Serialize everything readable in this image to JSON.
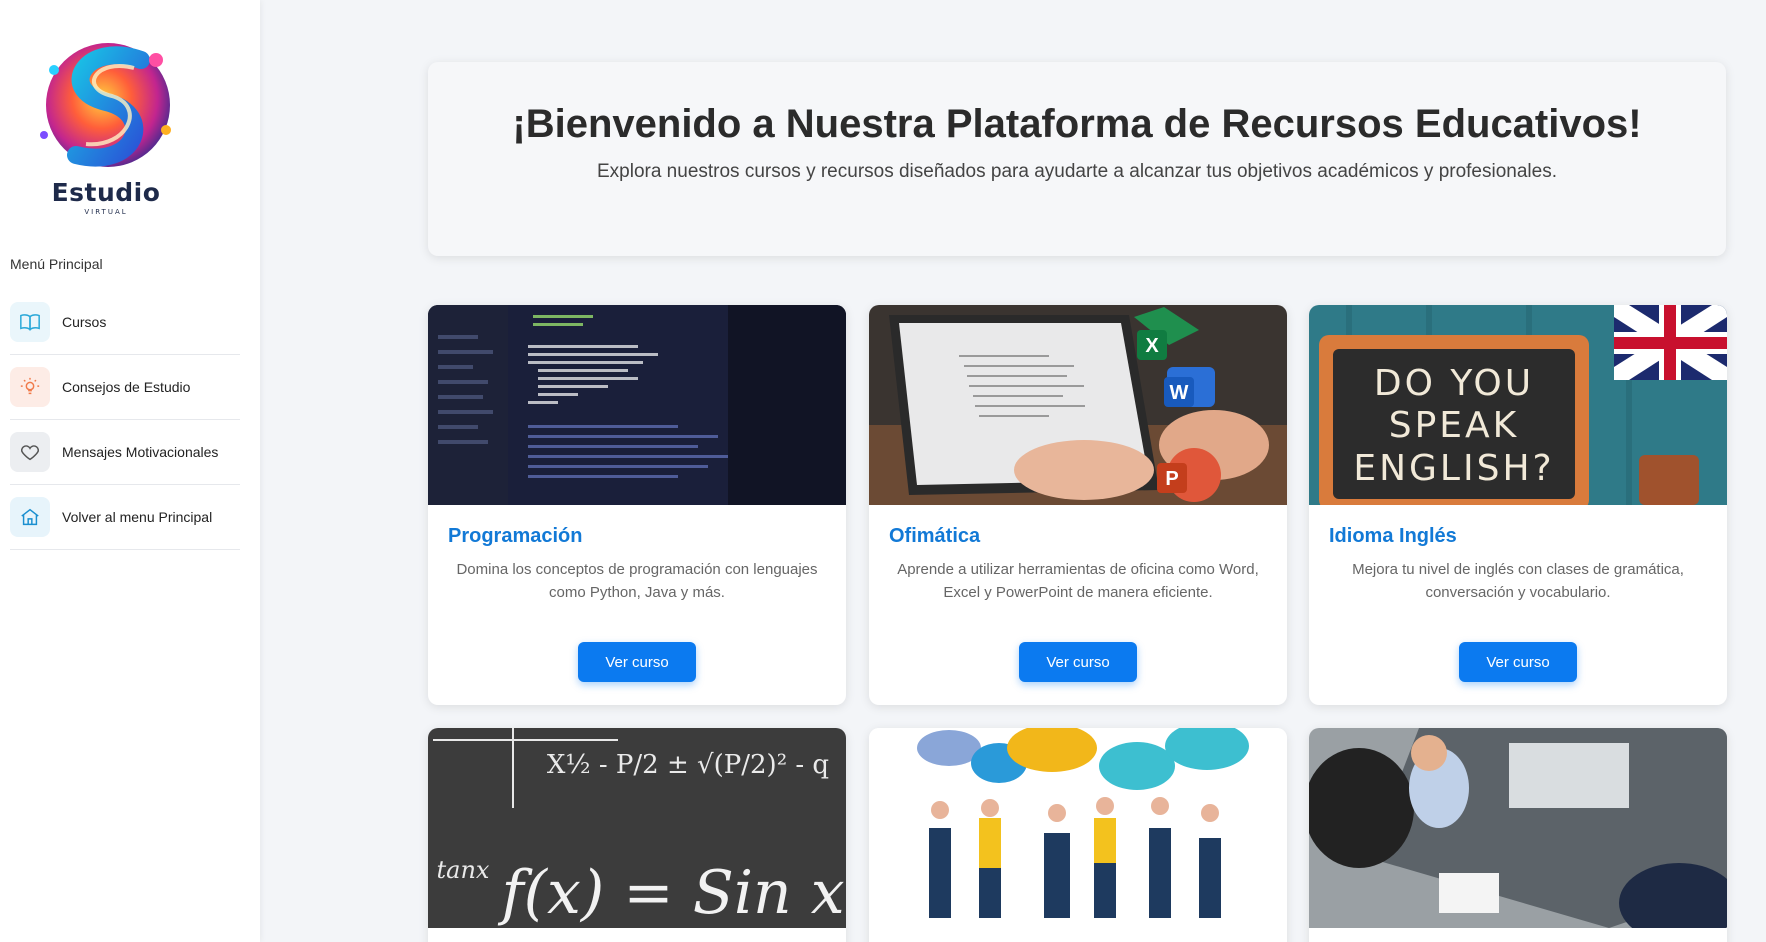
{
  "brand": {
    "name": "Estudio",
    "tagline": "VIRTUAL"
  },
  "sidebar": {
    "menu_title": "Menú Principal",
    "items": [
      {
        "label": "Cursos",
        "icon": "book-icon",
        "color": "#eaf6fb"
      },
      {
        "label": "Consejos de Estudio",
        "icon": "lightbulb-icon",
        "color": "#fdece6"
      },
      {
        "label": "Mensajes Motivacionales",
        "icon": "heart-icon",
        "color": "#eceef1"
      },
      {
        "label": "Volver al menu Principal",
        "icon": "home-icon",
        "color": "#e7f4fb"
      }
    ]
  },
  "hero": {
    "title": "¡Bienvenido a Nuestra Plataforma de Recursos Educativos!",
    "subtitle": "Explora nuestros cursos y recursos diseñados para ayudarte a alcanzar tus objetivos académicos y profesionales."
  },
  "courses": [
    {
      "title": "Programación",
      "description": "Domina los conceptos de programación con lenguajes como Python, Java y más.",
      "button": "Ver curso",
      "image": "code-screen-image"
    },
    {
      "title": "Ofimática",
      "description": "Aprende a utilizar herramientas de oficina como Word, Excel y PowerPoint de manera eficiente.",
      "button": "Ver curso",
      "image": "office-laptop-image"
    },
    {
      "title": "Idioma Inglés",
      "description": "Mejora tu nivel de inglés con clases de gramática, conversación y vocabulario.",
      "button": "Ver curso",
      "image": "english-chalkboard-image"
    }
  ],
  "images": {
    "english_board": [
      "DO YOU",
      "SPEAK",
      "ENGLISH?"
    ],
    "math_board": "f(x) = Sin x",
    "math_formula": "X½ - P/2 ± √(P/2)² - q",
    "math_small": "tanx",
    "office_letters": [
      "X",
      "W",
      "P"
    ]
  },
  "colors": {
    "accent": "#0b7af0",
    "title": "#1279d6",
    "background": "#f3f5f8"
  }
}
